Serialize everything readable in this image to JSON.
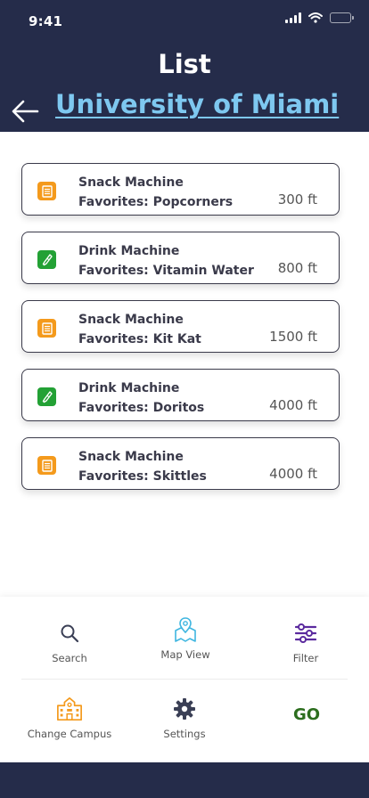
{
  "status_bar": {
    "time": "9:41"
  },
  "header": {
    "title": "List",
    "campus": "University of Miami"
  },
  "machines": [
    {
      "type": "Snack Machine",
      "favorites": "Favorites: Popcorners",
      "distance": "300 ft",
      "icon": "snack-machine-icon"
    },
    {
      "type": "Drink Machine",
      "favorites": "Favorites: Vitamin Water",
      "distance": "800 ft",
      "icon": "drink-machine-icon"
    },
    {
      "type": "Snack Machine",
      "favorites": "Favorites: Kit Kat",
      "distance": "1500 ft",
      "icon": "snack-machine-icon"
    },
    {
      "type": "Drink Machine",
      "favorites": "Favorites: Doritos",
      "distance": "4000 ft",
      "icon": "drink-machine-icon"
    },
    {
      "type": "Snack Machine",
      "favorites": "Favorites: Skittles",
      "distance": "4000 ft",
      "icon": "snack-machine-icon"
    }
  ],
  "nav": {
    "search": "Search",
    "map_view": "Map View",
    "filter": "Filter",
    "change_campus": "Change Campus",
    "settings": "Settings",
    "go": "GO"
  },
  "colors": {
    "header_bg": "#252c4a",
    "campus_link": "#7ec8f0",
    "snack_icon": "#f49a1c",
    "drink_icon": "#23a135",
    "filter_accent": "#5b2a9e",
    "map_accent": "#3fb6e0",
    "go_green": "#2c6e1e"
  }
}
